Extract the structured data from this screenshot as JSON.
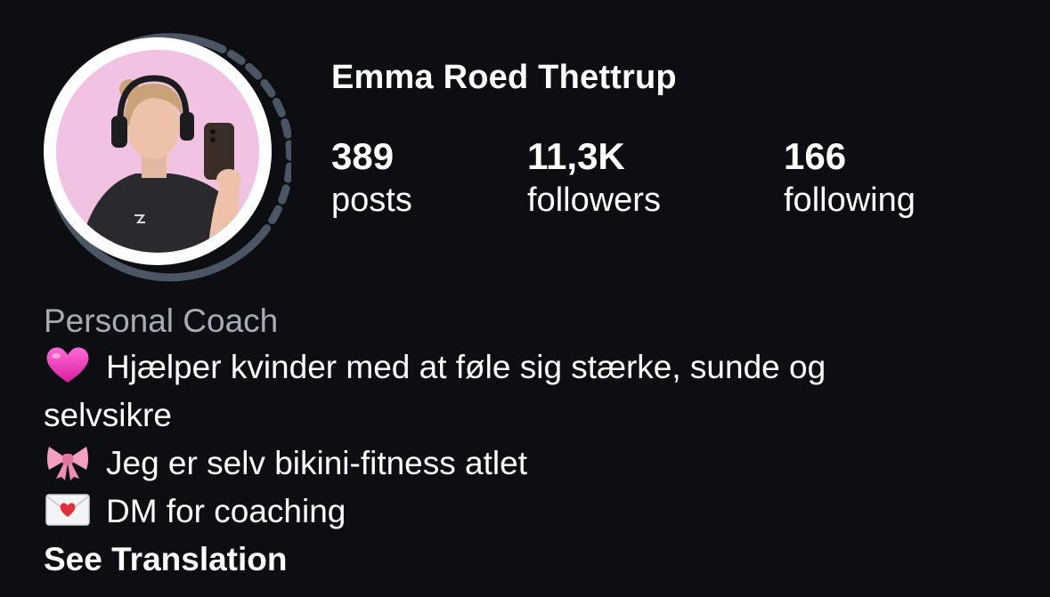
{
  "profile": {
    "name": "Emma Roed Thettrup",
    "avatar_alt": "profile-photo"
  },
  "stats": {
    "posts": {
      "count": "389",
      "label": "posts"
    },
    "followers": {
      "count": "11,3K",
      "label": "followers"
    },
    "following": {
      "count": "166",
      "label": "following"
    }
  },
  "bio": {
    "category": "Personal Coach",
    "line1": "Hjælper kvinder med at føle sig stærke, sunde og",
    "line1b": "selvsikre",
    "line2": "Jeg er selv bikini-fitness atlet",
    "line3": "DM for coaching",
    "icons": [
      "pink-heart-icon",
      "ribbon-bow-icon",
      "love-letter-icon"
    ]
  },
  "actions": {
    "see_translation": "See Translation"
  },
  "colors": {
    "background": "#0c0e12",
    "muted_text": "#a7abb3",
    "ring": "#4b5563",
    "avatar_bg": "#f2c2e3"
  }
}
